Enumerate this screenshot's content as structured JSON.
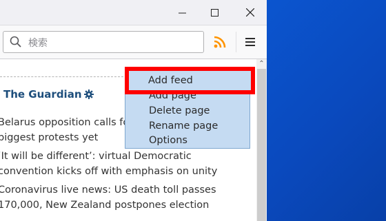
{
  "window": {
    "controls": {
      "minimize": "—",
      "maximize": "☐",
      "close": "✕"
    }
  },
  "toolbar": {
    "search_placeholder": "検索",
    "rss_icon": "rss-icon",
    "menu_icon": "hamburger-menu-icon",
    "accent_color": "#ff9400"
  },
  "feed": {
    "title": "The Guardian",
    "items": [
      {
        "line1": "Belarus opposition calls for",
        "line2": "biggest protests yet"
      },
      {
        "line1": "‘It will be different’: virtual Democratic",
        "line2": "convention kicks off with emphasis on unity"
      },
      {
        "line1": "Coronavirus live news: US death toll passes",
        "line2": "170,000, New Zealand postpones election"
      }
    ]
  },
  "context_menu": {
    "highlighted": "Add feed",
    "items": [
      "Add page",
      "Delete page",
      "Rename page",
      "Options"
    ],
    "highlight_color": "#ff0000"
  }
}
